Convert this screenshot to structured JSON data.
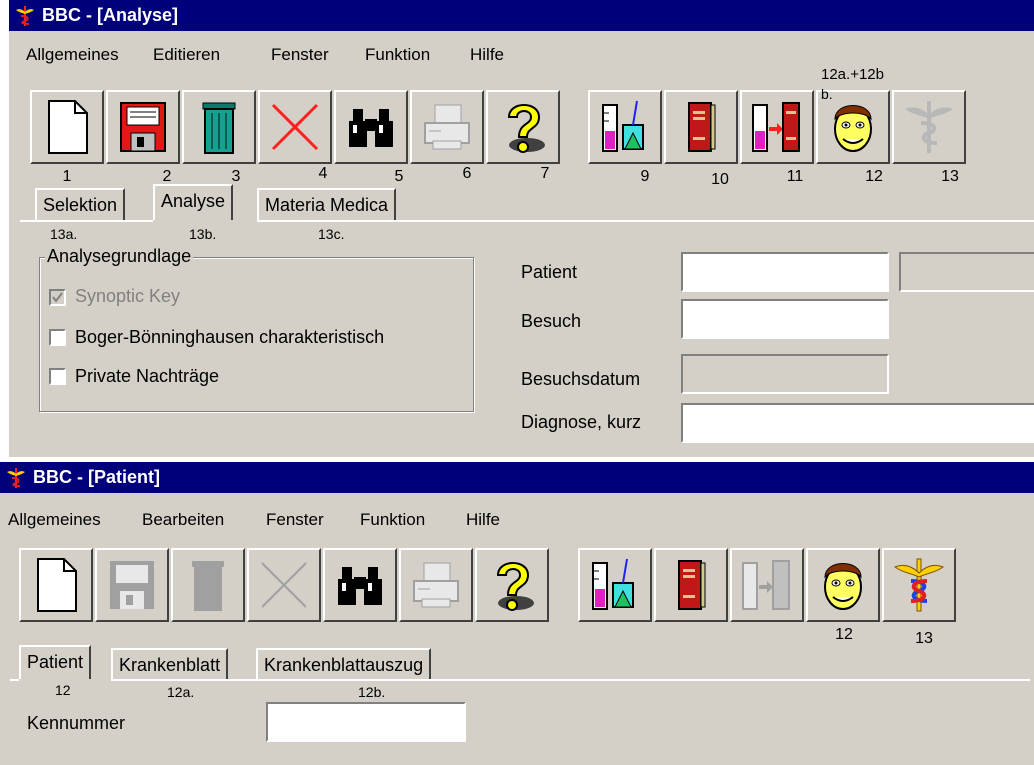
{
  "window1": {
    "title": "BBC - [Analyse]",
    "menu": [
      "Allgemeines",
      "Editieren",
      "Fenster",
      "Funktion",
      "Hilfe"
    ],
    "annotation_top": "12a.+12b",
    "annotation_b": "b.",
    "toolbar_numbers": [
      "1",
      "2",
      "3",
      "4",
      "5",
      "6",
      "7",
      "9",
      "10",
      "11",
      "12",
      "13"
    ],
    "tabs": [
      "Selektion",
      "Analyse",
      "Materia Medica"
    ],
    "tab_annotations": [
      "13a.",
      "13b.",
      "13c."
    ],
    "group_title": "Analysegrundlage",
    "checkboxes": [
      {
        "label": "Synoptic Key",
        "checked": true,
        "disabled": true
      },
      {
        "label": "Boger-Bönninghausen charakteristisch",
        "checked": false,
        "disabled": false
      },
      {
        "label": "Private Nachträge",
        "checked": false,
        "disabled": false
      }
    ],
    "fields": {
      "patient_label": "Patient",
      "besuch_label": "Besuch",
      "besuchsdatum_label": "Besuchsdatum",
      "diagnose_label": "Diagnose, kurz"
    }
  },
  "window2": {
    "title": "BBC - [Patient]",
    "menu": [
      "Allgemeines",
      "Bearbeiten",
      "Fenster",
      "Funktion",
      "Hilfe"
    ],
    "toolbar_numbers": [
      "12",
      "13"
    ],
    "tabs": [
      "Patient",
      "Krankenblatt",
      "Krankenblattauszug"
    ],
    "tab_annotations": [
      "12",
      "12a.",
      "12b."
    ],
    "kennummer_label": "Kennummer"
  },
  "icons": [
    "new-document-icon",
    "floppy-save-icon",
    "trash-icon",
    "delete-x-icon",
    "binoculars-icon",
    "printer-icon",
    "help-question-icon",
    "lab-analysis-icon",
    "book-icon",
    "analysis-to-book-icon",
    "patient-face-icon",
    "caduceus-icon"
  ],
  "colors": {
    "titlebar": "#00007b",
    "face": "#d4d0c8"
  }
}
